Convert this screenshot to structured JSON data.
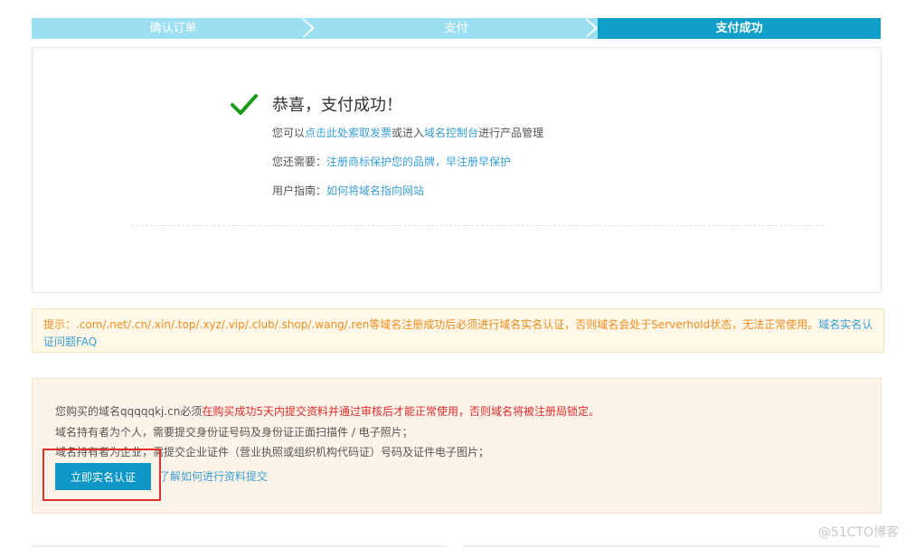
{
  "steps": [
    "确认订单",
    "支付",
    "支付成功"
  ],
  "success": {
    "title": "恭喜，支付成功！",
    "line1_prefix": "您可以",
    "line1_link1": "点击此处索取发票",
    "line1_mid": "或进入",
    "line1_link2": "域名控制台",
    "line1_suffix": "进行产品管理",
    "line2_prefix": "您还需要：",
    "line2_link": "注册商标保护您的品牌，早注册早保护",
    "line3_prefix": "用户指南：",
    "line3_link": "如何将域名指向网站"
  },
  "tip": {
    "text": "提示：.com/.net/.cn/.xin/.top/.xyz/.vip/.club/.shop/.wang/.ren等域名注册成功后必须进行域名实名认证，否则域名会处于Serverhold状态，无法正常使用。",
    "link": "域名实名认证问题FAQ"
  },
  "verify": {
    "line1_prefix": "您购买的域名qqqqqkj.cn必须",
    "line1_red": "在购买成功5天内提交资料并通过审核后才能正常使用，否则域名将被注册局锁定。",
    "line2": "域名持有者为个人，需要提交身份证号码及身份证正面扫描件 / 电子照片；",
    "line3": "域名持有者为企业，需提交企业证件（营业执照或组织机构代码证）号码及证件电子图片；",
    "button": "立即实名认证",
    "link": "了解如何进行资料提交"
  },
  "watermark": "@51CTO博客",
  "colors": {
    "step_inactive": "#9ddff2",
    "step_active": "#0e9fc8",
    "link": "#3a9fd4",
    "warn": "#f08c1e",
    "alert_red": "#e02a2a",
    "check": "#1a9a1a"
  }
}
